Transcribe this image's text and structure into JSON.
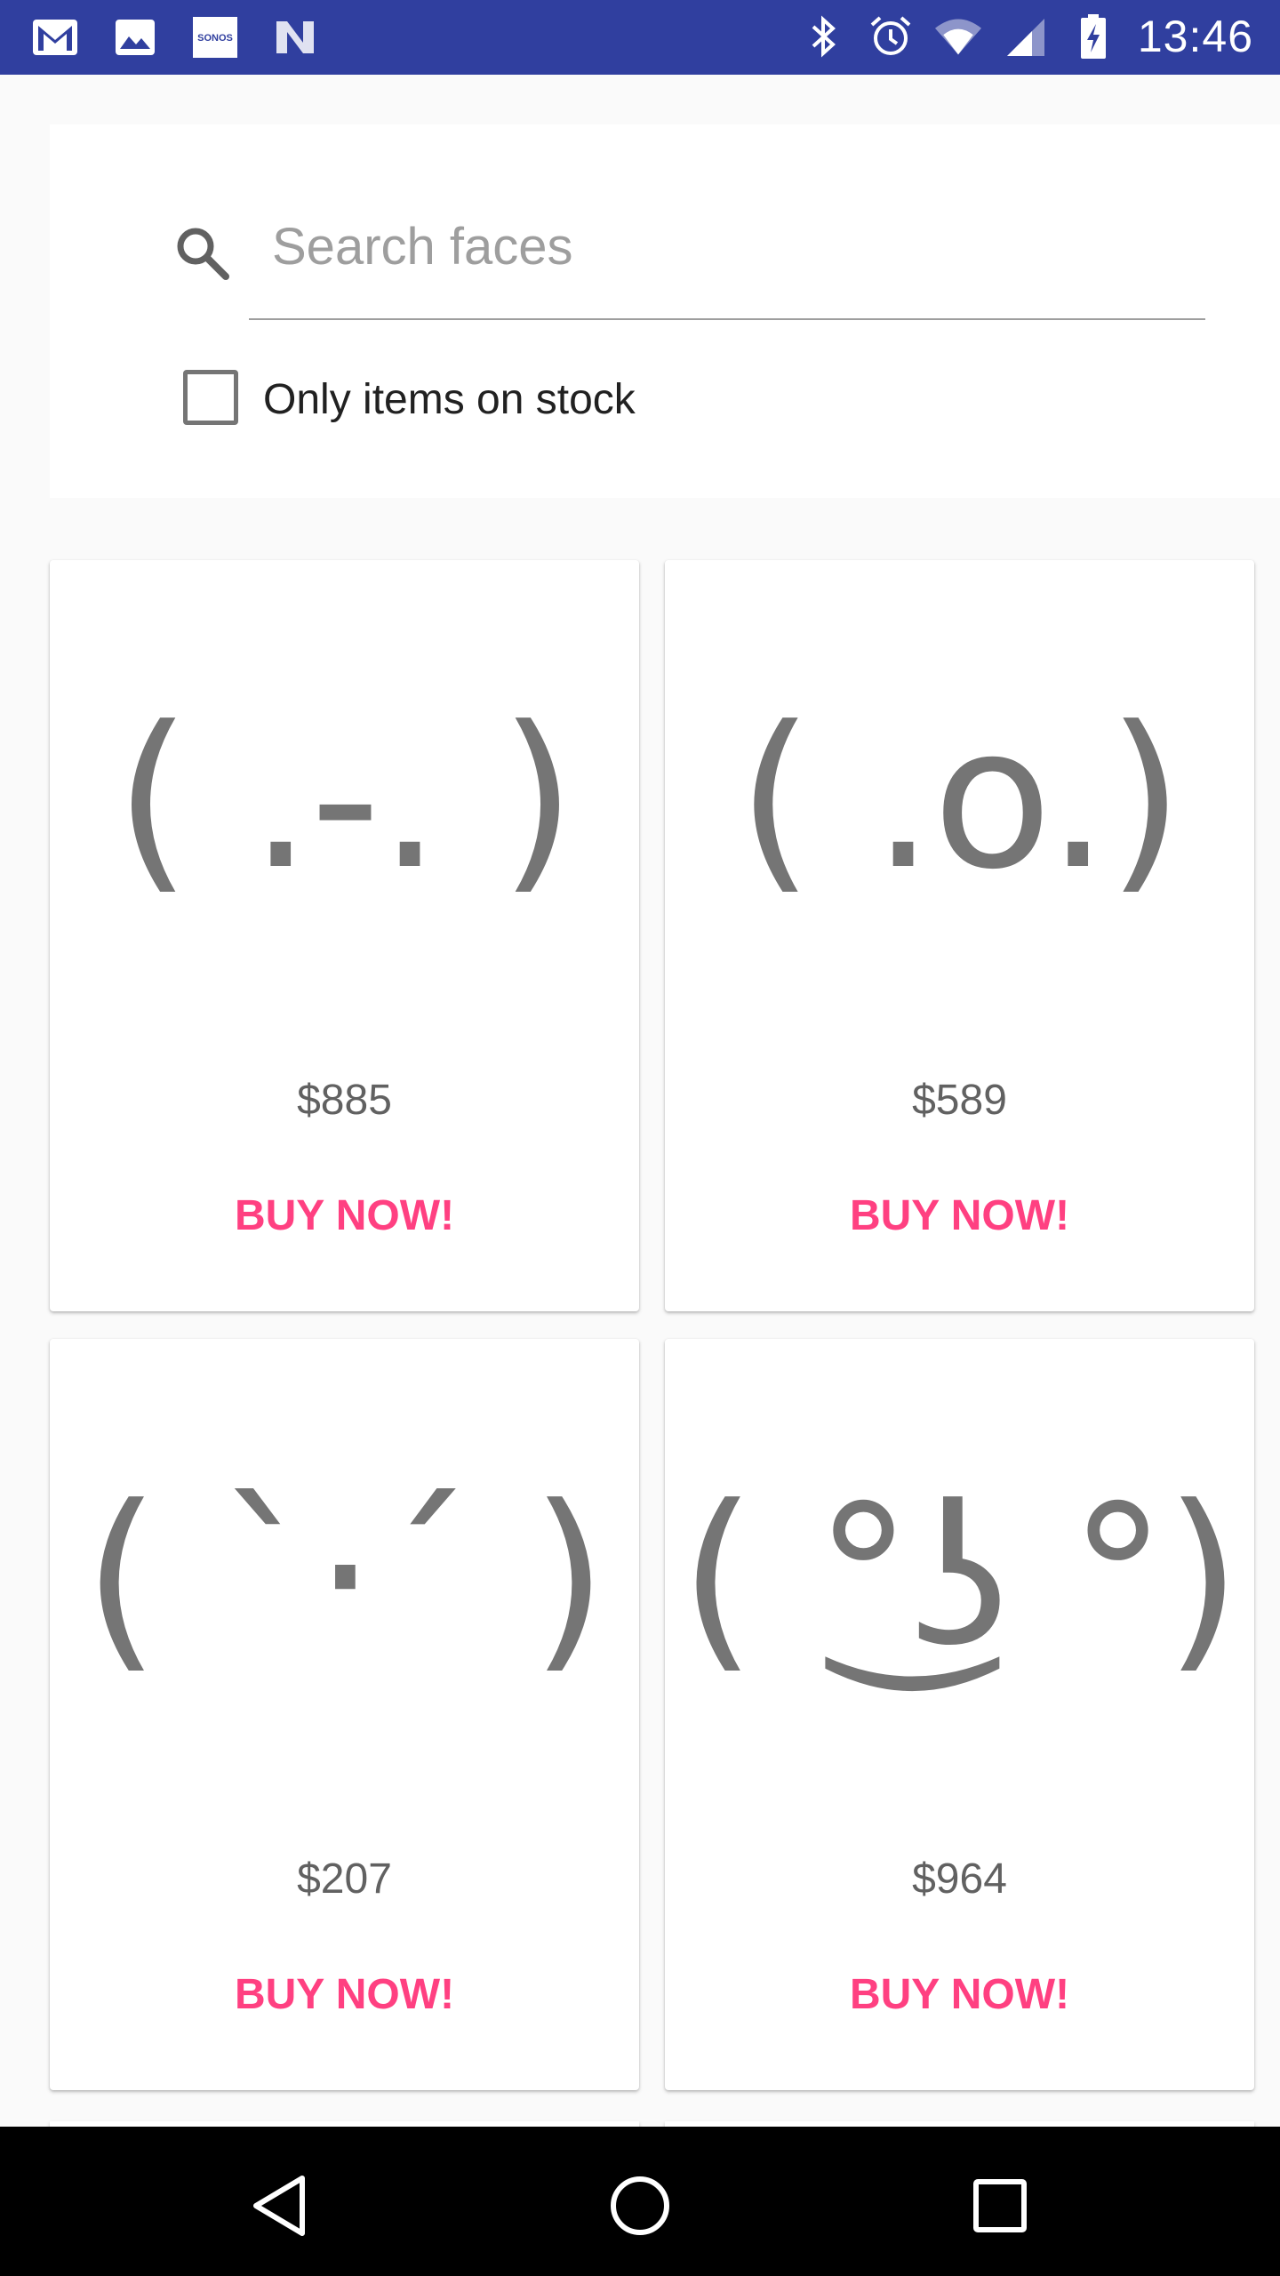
{
  "status_bar": {
    "time": "13:46",
    "left_icons": [
      "gmail-icon",
      "gallery-icon",
      "sonos-icon",
      "n-icon"
    ],
    "sonos_text": "SONOS",
    "right_icons": [
      "bluetooth-icon",
      "alarm-icon",
      "wifi-icon",
      "signal-icon",
      "battery-charging-icon"
    ],
    "color": "#303f9f"
  },
  "search": {
    "placeholder": "Search faces",
    "value": "",
    "checkbox_label": "Only items on stock",
    "checkbox_checked": false
  },
  "products": [
    {
      "face": "( .-. )",
      "price": "$885",
      "buy_label": "BUY NOW!"
    },
    {
      "face": "( .o.)",
      "price": "$589",
      "buy_label": "BUY NOW!"
    },
    {
      "face": "( `·´ )",
      "price": "$207",
      "buy_label": "BUY NOW!"
    },
    {
      "face": "( °͜ʖ °)",
      "price": "$964",
      "buy_label": "BUY NOW!"
    }
  ],
  "colors": {
    "accent": "#ff4081",
    "status_bar": "#303f9f",
    "face_gray": "#757575"
  },
  "nav_bar": {
    "buttons": [
      "back-icon",
      "home-icon",
      "recents-icon"
    ]
  }
}
